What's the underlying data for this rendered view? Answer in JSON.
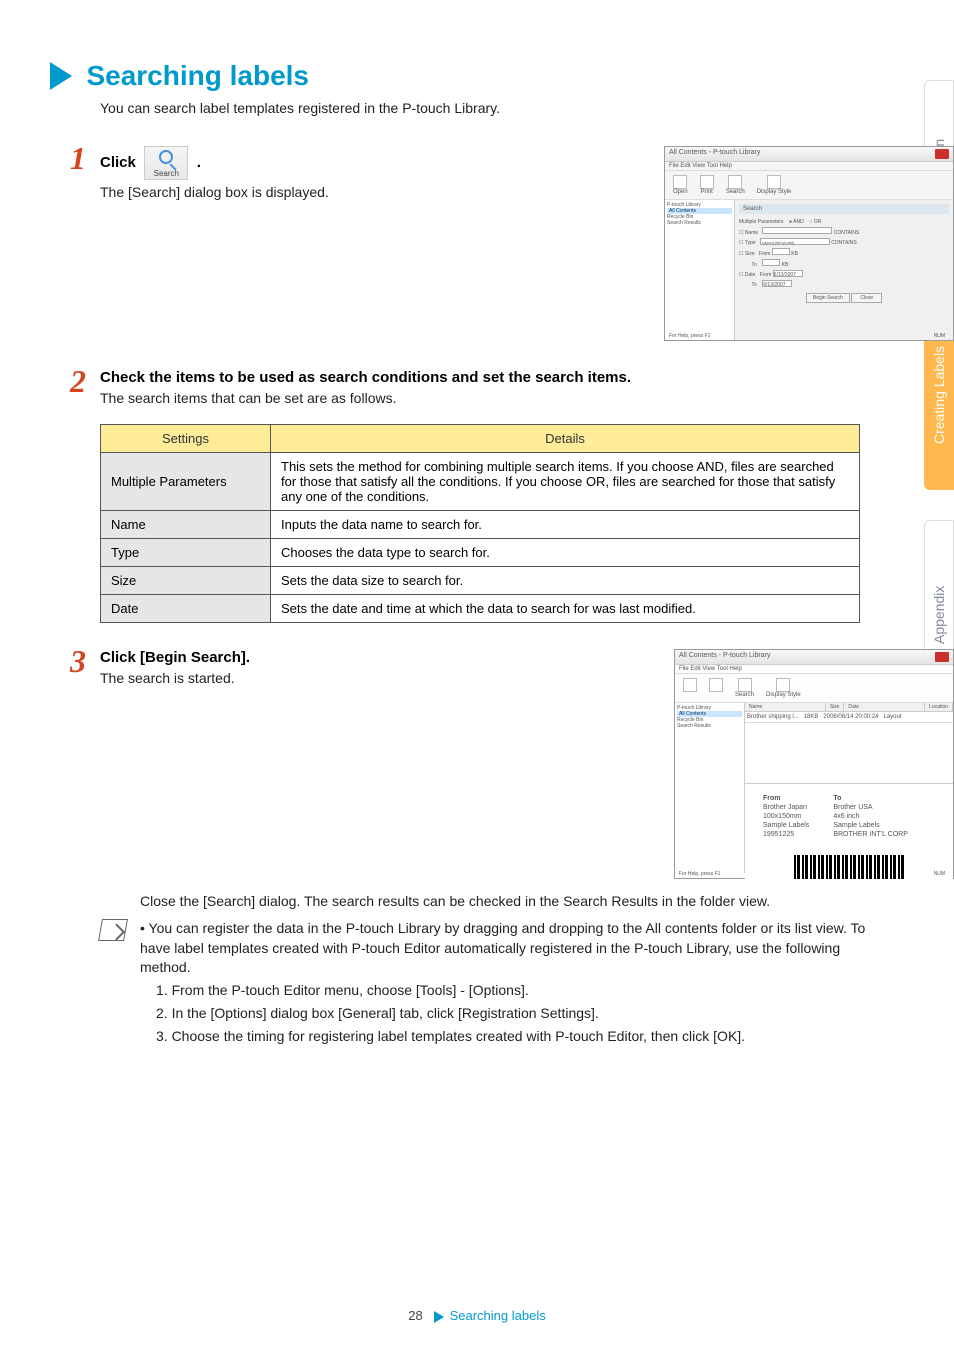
{
  "heading": "Searching labels",
  "intro": "You can search label templates registered in the P-touch Library.",
  "step1": {
    "label_click": "Click",
    "period": ".",
    "icon_label": "Search",
    "sub": "The [Search] dialog box is displayed."
  },
  "step2": {
    "title": "Check the items to be used as search conditions and set the search items.",
    "sub": "The search items that can be set are as follows."
  },
  "table": {
    "head_settings": "Settings",
    "head_details": "Details",
    "rows": [
      {
        "setting": "Multiple Parameters",
        "detail": "This sets the method for combining multiple search items. If you choose AND, files are searched for those that satisfy all the conditions. If you choose OR, files are searched for those that satisfy any one of the conditions."
      },
      {
        "setting": "Name",
        "detail": "Inputs the data name to search for."
      },
      {
        "setting": "Type",
        "detail": "Chooses the data type to search for."
      },
      {
        "setting": "Size",
        "detail": "Sets the data size to search for."
      },
      {
        "setting": "Date",
        "detail": "Sets the date and time at which the data to search for was last modified."
      }
    ]
  },
  "step3": {
    "title": "Click [Begin Search].",
    "sub": "The search is started."
  },
  "close_hint": "Close the [Search] dialog. The search results can be checked in the Search Results in the folder view.",
  "note": {
    "bullet": "You can register the data in the P-touch Library by dragging and dropping to the All contents folder or its list view. To have label templates created with P-touch Editor automatically registered in the P-touch Library, use the following method.",
    "n1": "1. From the P-touch Editor menu, choose [Tools] - [Options].",
    "n2": "2. In the [Options] dialog box [General] tab, click [Registration Settings].",
    "n3": "3. Choose the timing for registering label templates created with P-touch Editor, then click [OK]."
  },
  "tabs": {
    "t1": "Introduction",
    "t2": "Creating Labels",
    "t3": "Appendix"
  },
  "footer": {
    "page": "28",
    "link": "Searching labels"
  },
  "screenshot1": {
    "title": "All Contents - P-touch Library",
    "menu": "File   Edit   View   Tool   Help",
    "tool_open": "Open",
    "tool_print": "Print",
    "tool_search": "Search",
    "tool_display": "Display Style",
    "tree_root": "P-touch Library",
    "tree_all": "All Contents",
    "tree_recycle": "Recycle Bin",
    "tree_results": "Search Results",
    "search_hdr": "Search",
    "multi": "Multiple Parameters",
    "and": "AND",
    "or": "OR",
    "name": "Name",
    "type": "Type",
    "type_val": "Layout (lbl;lyt;mbl)",
    "contains": "CONTAINS",
    "size": "Size",
    "from": "From",
    "to": "To",
    "kb": "KB",
    "date": "Date",
    "d1": "6/13/2007",
    "d2": "6/13/2007",
    "begin": "Begin Search",
    "close": "Close",
    "status": "For Help, press F1",
    "num": "NUM"
  },
  "screenshot2": {
    "title": "All Contents - P-touch Library",
    "menu": "File   Edit   View   Tool   Help",
    "tool_search": "Search",
    "tool_display": "Display Style",
    "tree_root": "P-touch Library",
    "tree_all": "All Contents",
    "tree_recycle": "Recycle Bin",
    "tree_results": "Search Results",
    "col_name": "Name",
    "col_size": "Size",
    "col_date": "Date",
    "col_location": "Location",
    "row_name": "Brother shipping l...",
    "row_size": "18KB",
    "row_date": "2006/06/14 20:00:24",
    "row_type": "Layout",
    "from_h": "From",
    "from_l1": "Brother Japan",
    "from_l2": "100x150mm",
    "from_l3": "Sample Labels",
    "from_l4": "19951225",
    "to_h": "To",
    "to_l1": "Brother USA",
    "to_l2": "4x6 inch",
    "to_l3": "Sample Labels",
    "to_l4": "BROTHER INT'L CORP",
    "status": "For Help, press F1",
    "num": "NUM"
  }
}
